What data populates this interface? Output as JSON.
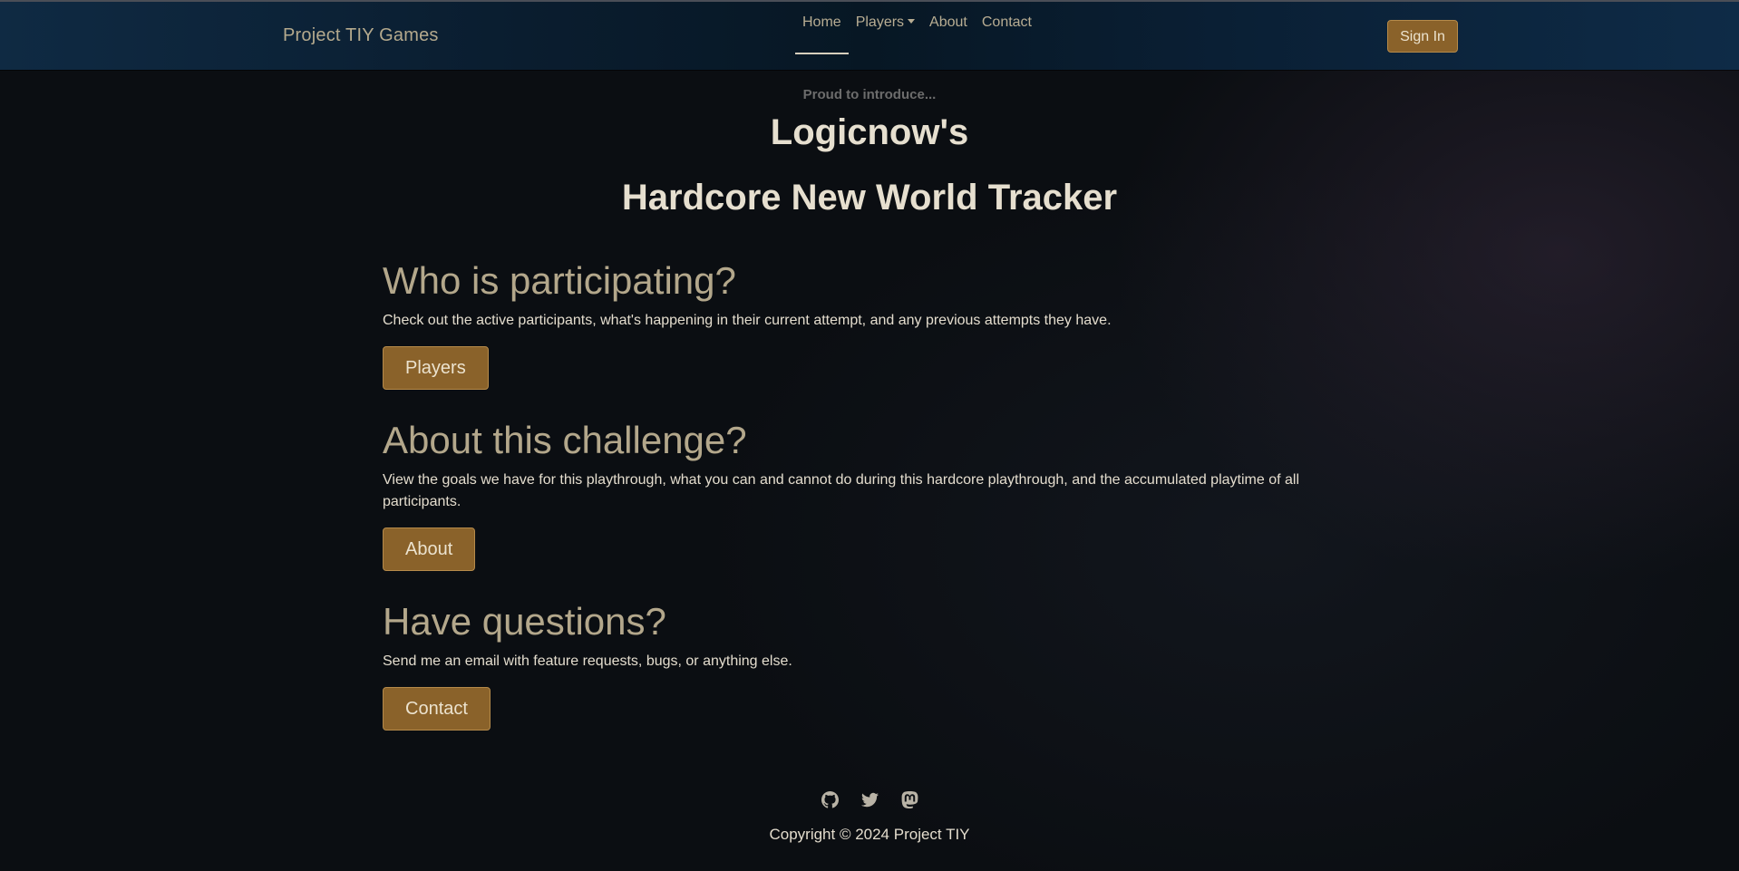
{
  "nav": {
    "brand": "Project TIY Games",
    "links": [
      {
        "label": "Home",
        "active": true
      },
      {
        "label": "Players",
        "dropdown": true
      },
      {
        "label": "About"
      },
      {
        "label": "Contact"
      }
    ],
    "sign_in": "Sign In"
  },
  "hero": {
    "pre": "Proud to introduce...",
    "title": "Logicnow's",
    "subtitle": "Hardcore New World Tracker"
  },
  "sections": [
    {
      "heading": "Who is participating?",
      "text": "Check out the active participants, what's happening in their current attempt, and any previous attempts they have.",
      "button": "Players"
    },
    {
      "heading": "About this challenge?",
      "text": "View the goals we have for this playthrough, what you can and cannot do during this hardcore playthrough, and the accumulated playtime of all participants.",
      "button": "About"
    },
    {
      "heading": "Have questions?",
      "text": "Send me an email with feature requests, bugs, or anything else.",
      "button": "Contact"
    }
  ],
  "footer": {
    "icons": [
      "github-icon",
      "twitter-icon",
      "mastodon-icon"
    ],
    "copyright": "Copyright © 2024 Project TIY"
  },
  "colors": {
    "accent": "#8a622a",
    "accent_border": "#b58a4a",
    "heading": "#b3a78b",
    "navbar": "#0a1d2f",
    "background": "#0b0e12"
  }
}
